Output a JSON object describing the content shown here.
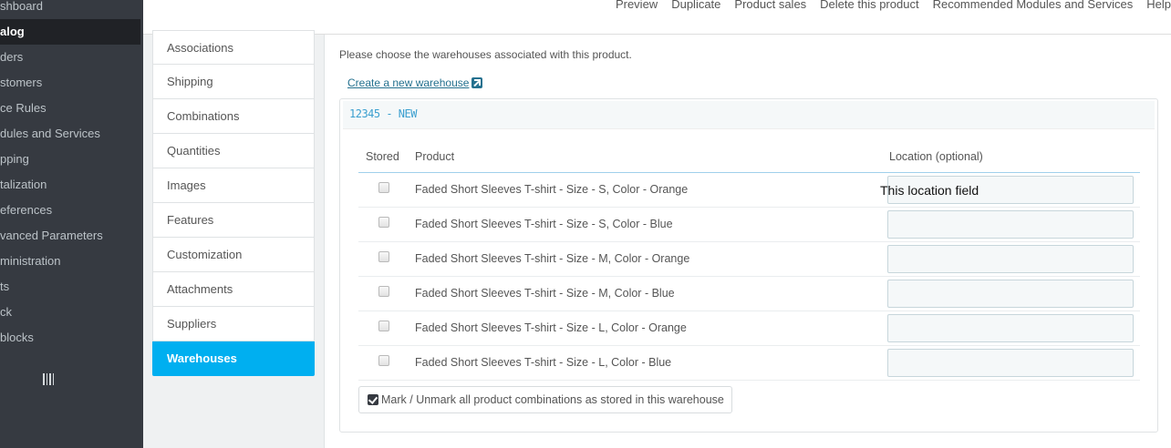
{
  "sidebar": {
    "items": [
      {
        "label": "shboard"
      },
      {
        "label": "alog",
        "active": true
      },
      {
        "label": "ders"
      },
      {
        "label": "stomers"
      },
      {
        "label": "ce Rules"
      },
      {
        "label": "dules and Services"
      },
      {
        "label": "pping"
      },
      {
        "label": "talization"
      },
      {
        "label": "eferences"
      },
      {
        "label": "vanced Parameters"
      },
      {
        "label": "ministration"
      },
      {
        "label": "ts"
      },
      {
        "label": "ck"
      },
      {
        "label": "blocks"
      }
    ]
  },
  "toolbar": {
    "preview": "Preview",
    "duplicate": "Duplicate",
    "product_sales": "Product sales",
    "delete": "Delete this product",
    "recommended": "Recommended Modules and Services",
    "help": "Help"
  },
  "tabs": [
    {
      "label": "Associations"
    },
    {
      "label": "Shipping"
    },
    {
      "label": "Combinations"
    },
    {
      "label": "Quantities"
    },
    {
      "label": "Images"
    },
    {
      "label": "Features"
    },
    {
      "label": "Customization"
    },
    {
      "label": "Attachments"
    },
    {
      "label": "Suppliers"
    },
    {
      "label": "Warehouses",
      "active": true
    }
  ],
  "content": {
    "intro": "Please choose the warehouses associated with this product.",
    "create_link": "Create a new warehouse",
    "warehouse_title": "12345 - NEW",
    "headers": {
      "stored": "Stored",
      "product": "Product",
      "location": "Location (optional)"
    },
    "rows": [
      {
        "product": "Faded Short Sleeves T-shirt - Size - S, Color - Orange",
        "stored": false,
        "location": ""
      },
      {
        "product": "Faded Short Sleeves T-shirt - Size - S, Color - Blue",
        "stored": false,
        "location": ""
      },
      {
        "product": "Faded Short Sleeves T-shirt - Size - M, Color - Orange",
        "stored": false,
        "location": ""
      },
      {
        "product": "Faded Short Sleeves T-shirt - Size - M, Color - Blue",
        "stored": false,
        "location": ""
      },
      {
        "product": "Faded Short Sleeves T-shirt - Size - L, Color - Orange",
        "stored": false,
        "location": ""
      },
      {
        "product": "Faded Short Sleeves T-shirt - Size - L, Color - Blue",
        "stored": false,
        "location": ""
      }
    ],
    "annotation": "This location field",
    "mark_all": "Mark / Unmark all product combinations as stored in this warehouse"
  },
  "colors": {
    "sidebar_bg": "#363a41",
    "accent": "#00aff0",
    "link": "#25718f"
  }
}
